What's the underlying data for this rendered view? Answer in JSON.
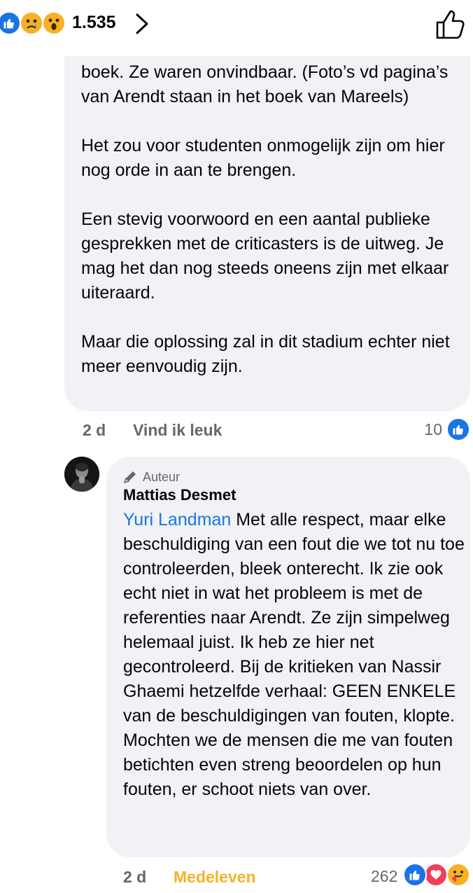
{
  "reactions_bar": {
    "icons": [
      "like-icon",
      "sad-face-icon",
      "wow-face-icon"
    ],
    "count": "1.535",
    "colors": {
      "like": "#1b74e4",
      "emoji": "#f7b125"
    }
  },
  "comment_1": {
    "paragraphs": [
      "boek. Ze waren onvindbaar. (Foto’s vd pagina’s van Arendt staan in het boek van Mareels)",
      "Het zou voor studenten onmogelijk zijn om hier nog orde in aan te brengen.",
      "Een stevig voorwoord en een aantal publieke gesprekken met de criticasters is de uitweg. Je mag het dan nog steeds oneens zijn met elkaar uiteraard.",
      "Maar die oplossing zal in dit stadium echter niet meer eenvoudig zijn."
    ],
    "time": "2 d",
    "action": "Vind ik leuk",
    "reaction_count": "10"
  },
  "comment_2": {
    "badge": "Auteur",
    "author": "Mattias Desmet",
    "mention": "Yuri Landman",
    "text": " Met alle respect, maar elke beschuldiging van een fout die we tot nu toe controleerden, bleek onterecht. Ik zie ook echt niet in wat het probleem is met de referenties naar Arendt. Ze zijn simpelweg helemaal juist. Ik heb ze hier net gecontroleerd. Bij de kritieken van Nassir Ghaemi hetzelfde verhaal: GEEN ENKELE van de beschuldigingen van fouten, klopte. Mochten we de mensen die me van fouten betichten even streng beoordelen op hun fouten, er schoot niets van over.",
    "time": "2 d",
    "action": "Medeleven",
    "action_color": "#f7b125",
    "reaction_count": "262",
    "reaction_icons": [
      "like-icon",
      "love-icon",
      "care-icon"
    ]
  }
}
